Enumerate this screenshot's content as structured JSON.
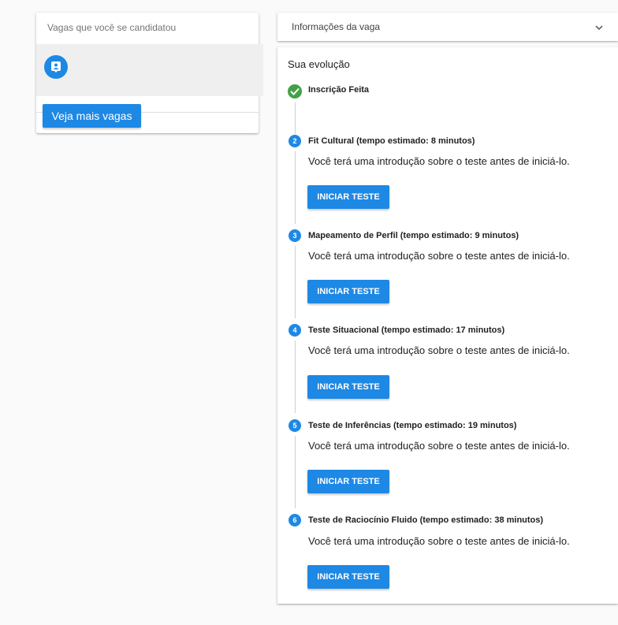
{
  "applied_jobs": {
    "title": "Vagas que você se candidatou",
    "more_button": "Veja mais vagas",
    "item_icon": "contact-badge-icon"
  },
  "job_info": {
    "label": "Informações da vaga",
    "expand_icon": "chevron-down-icon"
  },
  "evolution": {
    "title": "Sua evolução",
    "completed": {
      "label": "Inscrição Feita",
      "icon": "check-circle-icon"
    },
    "steps": [
      {
        "number": "2",
        "title": "Fit Cultural (tempo estimado: 8 minutos)",
        "description": "Você terá uma introdução sobre o teste antes de iniciá-lo.",
        "button": "INICIAR TESTE"
      },
      {
        "number": "3",
        "title": "Mapeamento de Perfil (tempo estimado: 9 minutos)",
        "description": "Você terá uma introdução sobre o teste antes de iniciá-lo.",
        "button": "INICIAR TESTE"
      },
      {
        "number": "4",
        "title": "Teste Situacional (tempo estimado: 17 minutos)",
        "description": "Você terá uma introdução sobre o teste antes de iniciá-lo.",
        "button": "INICIAR TESTE"
      },
      {
        "number": "5",
        "title": "Teste de Inferências (tempo estimado: 19 minutos)",
        "description": "Você terá uma introdução sobre o teste antes de iniciá-lo.",
        "button": "INICIAR TESTE"
      },
      {
        "number": "6",
        "title": "Teste de Raciocínio Fluido (tempo estimado: 38 minutos)",
        "description": "Você terá uma introdução sobre o teste antes de iniciá-lo.",
        "button": "INICIAR TESTE"
      }
    ]
  },
  "colors": {
    "primary": "#1e88e5",
    "success": "#43a047"
  }
}
